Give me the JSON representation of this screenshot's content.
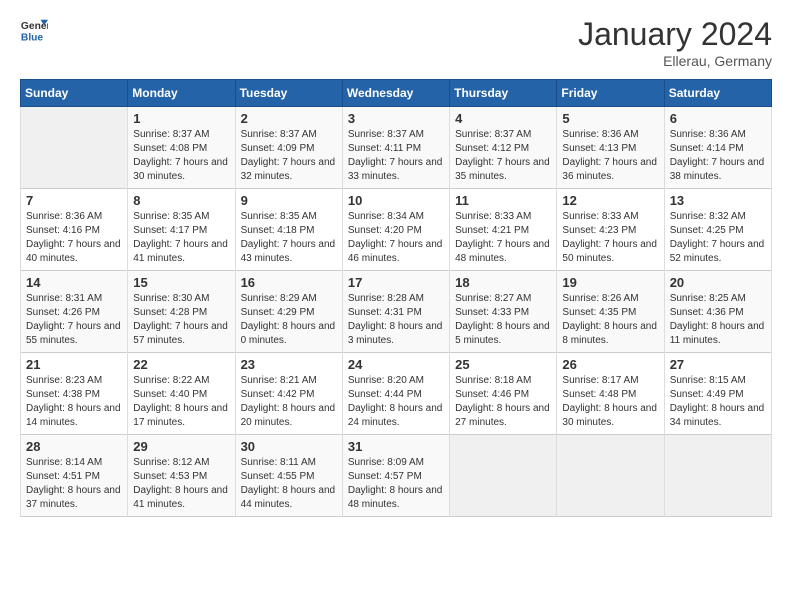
{
  "header": {
    "logo_line1": "General",
    "logo_line2": "Blue",
    "month": "January 2024",
    "location": "Ellerau, Germany"
  },
  "columns": [
    "Sunday",
    "Monday",
    "Tuesday",
    "Wednesday",
    "Thursday",
    "Friday",
    "Saturday"
  ],
  "rows": [
    [
      {
        "day": "",
        "sunrise": "",
        "sunset": "",
        "daylight": ""
      },
      {
        "day": "1",
        "sunrise": "Sunrise: 8:37 AM",
        "sunset": "Sunset: 4:08 PM",
        "daylight": "Daylight: 7 hours and 30 minutes."
      },
      {
        "day": "2",
        "sunrise": "Sunrise: 8:37 AM",
        "sunset": "Sunset: 4:09 PM",
        "daylight": "Daylight: 7 hours and 32 minutes."
      },
      {
        "day": "3",
        "sunrise": "Sunrise: 8:37 AM",
        "sunset": "Sunset: 4:11 PM",
        "daylight": "Daylight: 7 hours and 33 minutes."
      },
      {
        "day": "4",
        "sunrise": "Sunrise: 8:37 AM",
        "sunset": "Sunset: 4:12 PM",
        "daylight": "Daylight: 7 hours and 35 minutes."
      },
      {
        "day": "5",
        "sunrise": "Sunrise: 8:36 AM",
        "sunset": "Sunset: 4:13 PM",
        "daylight": "Daylight: 7 hours and 36 minutes."
      },
      {
        "day": "6",
        "sunrise": "Sunrise: 8:36 AM",
        "sunset": "Sunset: 4:14 PM",
        "daylight": "Daylight: 7 hours and 38 minutes."
      }
    ],
    [
      {
        "day": "7",
        "sunrise": "Sunrise: 8:36 AM",
        "sunset": "Sunset: 4:16 PM",
        "daylight": "Daylight: 7 hours and 40 minutes."
      },
      {
        "day": "8",
        "sunrise": "Sunrise: 8:35 AM",
        "sunset": "Sunset: 4:17 PM",
        "daylight": "Daylight: 7 hours and 41 minutes."
      },
      {
        "day": "9",
        "sunrise": "Sunrise: 8:35 AM",
        "sunset": "Sunset: 4:18 PM",
        "daylight": "Daylight: 7 hours and 43 minutes."
      },
      {
        "day": "10",
        "sunrise": "Sunrise: 8:34 AM",
        "sunset": "Sunset: 4:20 PM",
        "daylight": "Daylight: 7 hours and 46 minutes."
      },
      {
        "day": "11",
        "sunrise": "Sunrise: 8:33 AM",
        "sunset": "Sunset: 4:21 PM",
        "daylight": "Daylight: 7 hours and 48 minutes."
      },
      {
        "day": "12",
        "sunrise": "Sunrise: 8:33 AM",
        "sunset": "Sunset: 4:23 PM",
        "daylight": "Daylight: 7 hours and 50 minutes."
      },
      {
        "day": "13",
        "sunrise": "Sunrise: 8:32 AM",
        "sunset": "Sunset: 4:25 PM",
        "daylight": "Daylight: 7 hours and 52 minutes."
      }
    ],
    [
      {
        "day": "14",
        "sunrise": "Sunrise: 8:31 AM",
        "sunset": "Sunset: 4:26 PM",
        "daylight": "Daylight: 7 hours and 55 minutes."
      },
      {
        "day": "15",
        "sunrise": "Sunrise: 8:30 AM",
        "sunset": "Sunset: 4:28 PM",
        "daylight": "Daylight: 7 hours and 57 minutes."
      },
      {
        "day": "16",
        "sunrise": "Sunrise: 8:29 AM",
        "sunset": "Sunset: 4:29 PM",
        "daylight": "Daylight: 8 hours and 0 minutes."
      },
      {
        "day": "17",
        "sunrise": "Sunrise: 8:28 AM",
        "sunset": "Sunset: 4:31 PM",
        "daylight": "Daylight: 8 hours and 3 minutes."
      },
      {
        "day": "18",
        "sunrise": "Sunrise: 8:27 AM",
        "sunset": "Sunset: 4:33 PM",
        "daylight": "Daylight: 8 hours and 5 minutes."
      },
      {
        "day": "19",
        "sunrise": "Sunrise: 8:26 AM",
        "sunset": "Sunset: 4:35 PM",
        "daylight": "Daylight: 8 hours and 8 minutes."
      },
      {
        "day": "20",
        "sunrise": "Sunrise: 8:25 AM",
        "sunset": "Sunset: 4:36 PM",
        "daylight": "Daylight: 8 hours and 11 minutes."
      }
    ],
    [
      {
        "day": "21",
        "sunrise": "Sunrise: 8:23 AM",
        "sunset": "Sunset: 4:38 PM",
        "daylight": "Daylight: 8 hours and 14 minutes."
      },
      {
        "day": "22",
        "sunrise": "Sunrise: 8:22 AM",
        "sunset": "Sunset: 4:40 PM",
        "daylight": "Daylight: 8 hours and 17 minutes."
      },
      {
        "day": "23",
        "sunrise": "Sunrise: 8:21 AM",
        "sunset": "Sunset: 4:42 PM",
        "daylight": "Daylight: 8 hours and 20 minutes."
      },
      {
        "day": "24",
        "sunrise": "Sunrise: 8:20 AM",
        "sunset": "Sunset: 4:44 PM",
        "daylight": "Daylight: 8 hours and 24 minutes."
      },
      {
        "day": "25",
        "sunrise": "Sunrise: 8:18 AM",
        "sunset": "Sunset: 4:46 PM",
        "daylight": "Daylight: 8 hours and 27 minutes."
      },
      {
        "day": "26",
        "sunrise": "Sunrise: 8:17 AM",
        "sunset": "Sunset: 4:48 PM",
        "daylight": "Daylight: 8 hours and 30 minutes."
      },
      {
        "day": "27",
        "sunrise": "Sunrise: 8:15 AM",
        "sunset": "Sunset: 4:49 PM",
        "daylight": "Daylight: 8 hours and 34 minutes."
      }
    ],
    [
      {
        "day": "28",
        "sunrise": "Sunrise: 8:14 AM",
        "sunset": "Sunset: 4:51 PM",
        "daylight": "Daylight: 8 hours and 37 minutes."
      },
      {
        "day": "29",
        "sunrise": "Sunrise: 8:12 AM",
        "sunset": "Sunset: 4:53 PM",
        "daylight": "Daylight: 8 hours and 41 minutes."
      },
      {
        "day": "30",
        "sunrise": "Sunrise: 8:11 AM",
        "sunset": "Sunset: 4:55 PM",
        "daylight": "Daylight: 8 hours and 44 minutes."
      },
      {
        "day": "31",
        "sunrise": "Sunrise: 8:09 AM",
        "sunset": "Sunset: 4:57 PM",
        "daylight": "Daylight: 8 hours and 48 minutes."
      },
      {
        "day": "",
        "sunrise": "",
        "sunset": "",
        "daylight": ""
      },
      {
        "day": "",
        "sunrise": "",
        "sunset": "",
        "daylight": ""
      },
      {
        "day": "",
        "sunrise": "",
        "sunset": "",
        "daylight": ""
      }
    ]
  ]
}
